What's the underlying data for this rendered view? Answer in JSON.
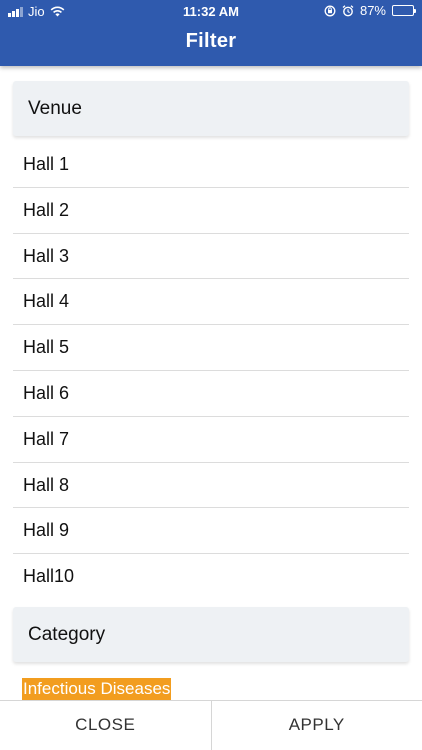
{
  "status_bar": {
    "carrier": "Jio",
    "time": "11:32 AM",
    "battery": "87%",
    "battery_level": 0.87
  },
  "header": {
    "title": "Filter"
  },
  "venue": {
    "heading": "Venue",
    "items": [
      "Hall 1",
      "Hall 2",
      "Hall 3",
      "Hall 4",
      "Hall 5",
      "Hall 6",
      "Hall 7",
      "Hall 8",
      "Hall 9",
      "Hall10"
    ]
  },
  "category": {
    "heading": "Category",
    "items": [
      {
        "label": "Infectious Diseases",
        "selected": true
      }
    ]
  },
  "footer": {
    "close_label": "CLOSE",
    "apply_label": "APPLY"
  },
  "colors": {
    "header": "#2f5aae",
    "selected": "#f29d1f",
    "section_bg": "#eef1f4"
  },
  "icons": [
    "signal-icon",
    "wifi-icon",
    "rotation-lock-icon",
    "alarm-icon",
    "battery-icon"
  ]
}
